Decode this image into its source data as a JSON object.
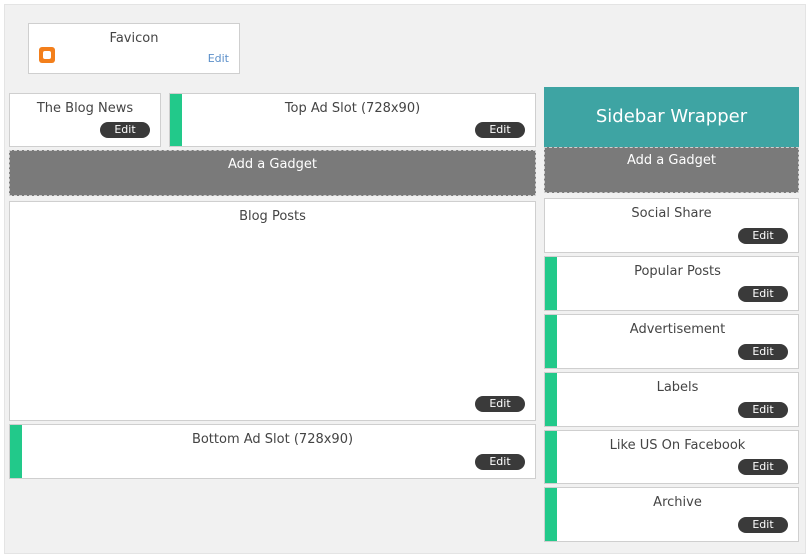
{
  "favicon": {
    "title": "Favicon",
    "edit": "Edit"
  },
  "blog_news": {
    "title": "The Blog News",
    "edit": "Edit"
  },
  "top_ad": {
    "title": "Top Ad Slot (728x90)",
    "edit": "Edit"
  },
  "main_add_gadget": "Add a Gadget",
  "blog_posts": {
    "title": "Blog Posts",
    "edit": "Edit"
  },
  "bottom_ad": {
    "title": "Bottom Ad Slot (728x90)",
    "edit": "Edit"
  },
  "sidebar": {
    "header": "Sidebar Wrapper",
    "add_gadget": "Add a Gadget",
    "widgets": [
      {
        "title": "Social Share",
        "edit": "Edit"
      },
      {
        "title": "Popular Posts",
        "edit": "Edit"
      },
      {
        "title": "Advertisement",
        "edit": "Edit"
      },
      {
        "title": "Labels",
        "edit": "Edit"
      },
      {
        "title": "Like US On Facebook",
        "edit": "Edit"
      },
      {
        "title": "Archive",
        "edit": "Edit"
      }
    ]
  },
  "colors": {
    "accent": "#22c98a",
    "sidebar_header": "#3ea4a3",
    "gadget_bg": "#7a7a7a",
    "button": "#3a3a3a",
    "favicon": "#f37f1b"
  },
  "icons": {
    "favicon": "blogger-icon"
  }
}
